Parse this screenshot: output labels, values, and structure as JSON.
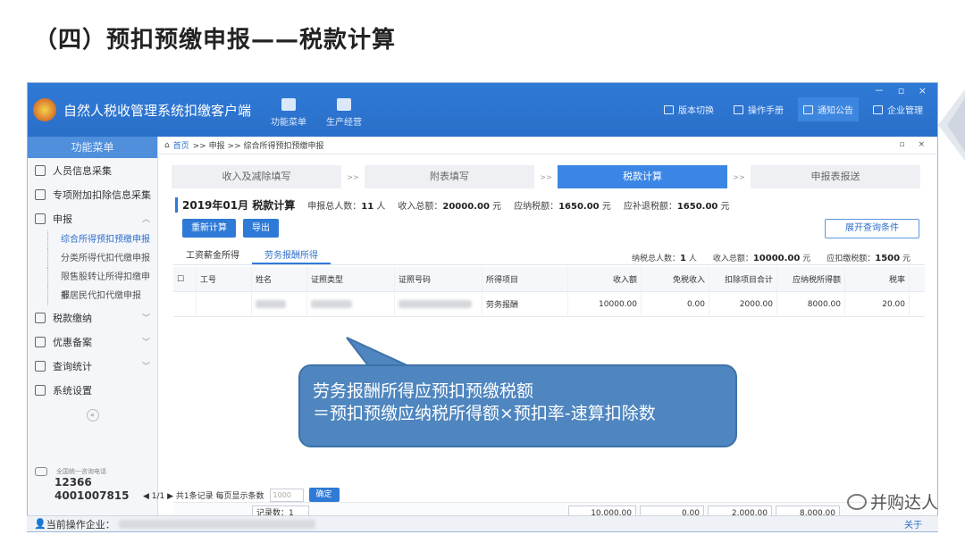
{
  "slide_title": "（四）预扣预缴申报——税款计算",
  "app": {
    "title": "自然人税收管理系统扣缴客户端",
    "window_controls": "－ ▫ ×",
    "top_nav": [
      {
        "label": "功能菜单",
        "icon": "wallet-icon"
      },
      {
        "label": "生产经营",
        "icon": "coins-icon"
      }
    ],
    "tools": [
      {
        "label": "版本切换",
        "icon": "switch-icon",
        "active": false
      },
      {
        "label": "操作手册",
        "icon": "manual-icon",
        "active": false
      },
      {
        "label": "通知公告",
        "icon": "mail-icon",
        "active": true
      },
      {
        "label": "企业管理",
        "icon": "building-icon",
        "active": false
      }
    ]
  },
  "sidebar": {
    "header": "功能菜单",
    "items": [
      {
        "label": "人员信息采集",
        "chevron": ""
      },
      {
        "label": "专项附加扣除信息采集",
        "chevron": "﹀"
      },
      {
        "label": "申报",
        "chevron": "︿"
      }
    ],
    "sub_items": [
      {
        "label": "综合所得预扣预缴申报",
        "active": true
      },
      {
        "label": "分类所得代扣代缴申报",
        "active": false
      },
      {
        "label": "限售股转让所得扣缴申报",
        "active": false
      },
      {
        "label": "非居民代扣代缴申报",
        "active": false
      }
    ],
    "items_after": [
      {
        "label": "税款缴纳",
        "chevron": "﹀"
      },
      {
        "label": "优惠备案",
        "chevron": "﹀"
      },
      {
        "label": "查询统计",
        "chevron": "﹀"
      },
      {
        "label": "系统设置",
        "chevron": ""
      }
    ],
    "collapse": "«",
    "hotline_caption": "全国统一咨询电话",
    "hotlines": [
      "12366",
      "4001007815"
    ]
  },
  "breadcrumb": {
    "home": "首页",
    "rest": ">> 申报 >> 综合所得预扣预缴申报",
    "controls": "▫ ×"
  },
  "steps": [
    {
      "label": "收入及减除填写",
      "active": false
    },
    {
      "label": "附表填写",
      "active": false
    },
    {
      "label": "税款计算",
      "active": true
    },
    {
      "label": "申报表报送",
      "active": false
    }
  ],
  "step_sep": ">>",
  "summary": {
    "title": "2019年01月  税款计算",
    "people_label": "申报总人数：",
    "people_value": "11",
    "people_unit": "人",
    "income_label": "收入总额：",
    "income_value": "20000.00",
    "income_unit": "元",
    "tax_label": "应纳税额：",
    "tax_value": "1650.00",
    "tax_unit": "元",
    "refund_label": "应补退税额：",
    "refund_value": "1650.00",
    "refund_unit": "元"
  },
  "buttons": {
    "recalc": "重新计算",
    "export": "导出",
    "expand_query": "展开查询条件"
  },
  "subtabs": [
    {
      "label": "工资薪金所得",
      "active": false
    },
    {
      "label": "劳务报酬所得",
      "active": true
    }
  ],
  "subsummary": {
    "people_label": "纳税总人数：",
    "people_value": "1",
    "people_unit": "人",
    "income_label": "收入总额：",
    "income_value": "10000.00",
    "income_unit": "元",
    "withhold_label": "应扣缴税额：",
    "withhold_value": "1500",
    "withhold_unit": "元"
  },
  "table": {
    "headers": [
      "工号",
      "姓名",
      "证照类型",
      "证照号码",
      "所得项目",
      "收入额",
      "免税收入",
      "扣除项目合计",
      "应纳税所得额",
      "税率"
    ],
    "rows": [
      {
        "id": "",
        "income_item": "劳务报酬",
        "income": "10000.00",
        "tax_free": "0.00",
        "deductions": "2000.00",
        "taxable": "8000.00",
        "rate": "20.00"
      }
    ],
    "footer": {
      "record_count": "记录数：1",
      "income": "10,000.00",
      "tax_free": "0.00",
      "deductions": "2,000.00",
      "taxable": "8,000.00"
    }
  },
  "pager": {
    "info": "◀ 1/1 ▶ 共1条记录  每页显示条数",
    "page_size_placeholder": "1000",
    "confirm": "确定"
  },
  "statusbar": {
    "label": "当前操作企业：",
    "about": "关于"
  },
  "callout": {
    "line1": "劳务报酬所得应预扣预缴税额",
    "line2": "＝预扣预缴应纳税所得额×预扣率-速算扣除数"
  },
  "watermark": "并购达人"
}
